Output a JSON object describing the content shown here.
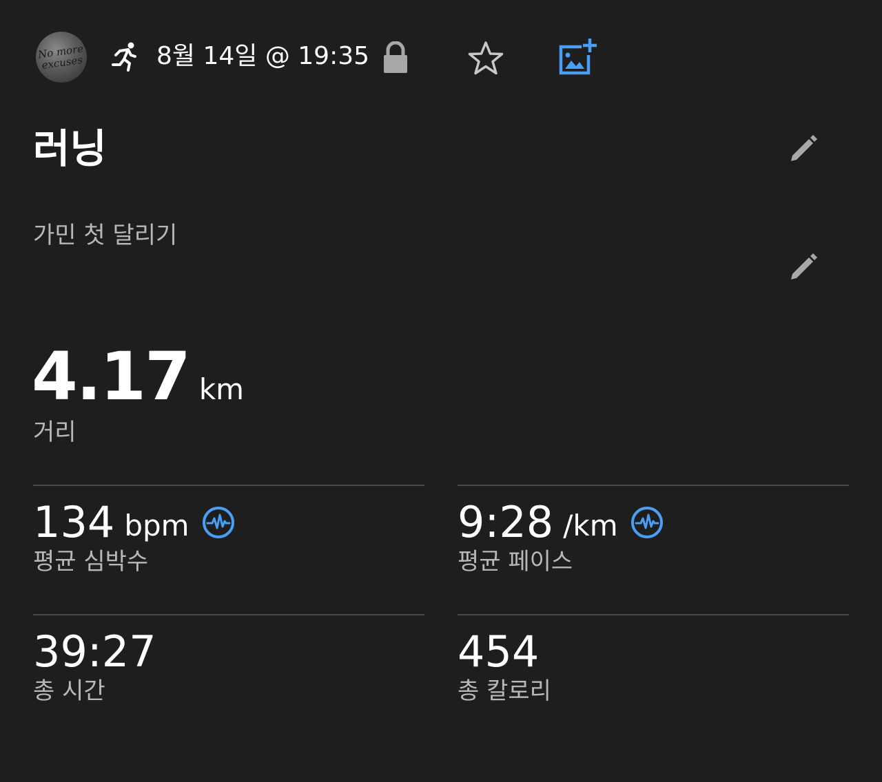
{
  "header": {
    "avatar_text": "No more\nexcuses",
    "activity_icon": "running-person-icon",
    "date": "8월 14일 @ 19:35",
    "privacy_icon": "lock-icon",
    "favorite_icon": "star-icon",
    "add_photo_icon": "add-photo-icon",
    "accent_color": "#4a9ff5"
  },
  "activity": {
    "title": "러닝",
    "description": "가민 첫 달리기",
    "edit_icon": "pencil-icon"
  },
  "distance": {
    "value": "4.17",
    "unit": "km",
    "label": "거리"
  },
  "stats": [
    {
      "value": "134",
      "unit": "bpm",
      "label": "평균 심박수",
      "icon": "heart-rate-icon"
    },
    {
      "value": "9:28",
      "unit": "/km",
      "label": "평균 페이스",
      "icon": "heart-rate-icon"
    },
    {
      "value": "39:27",
      "unit": "",
      "label": "총 시간",
      "icon": ""
    },
    {
      "value": "454",
      "unit": "",
      "label": "총 칼로리",
      "icon": ""
    }
  ]
}
